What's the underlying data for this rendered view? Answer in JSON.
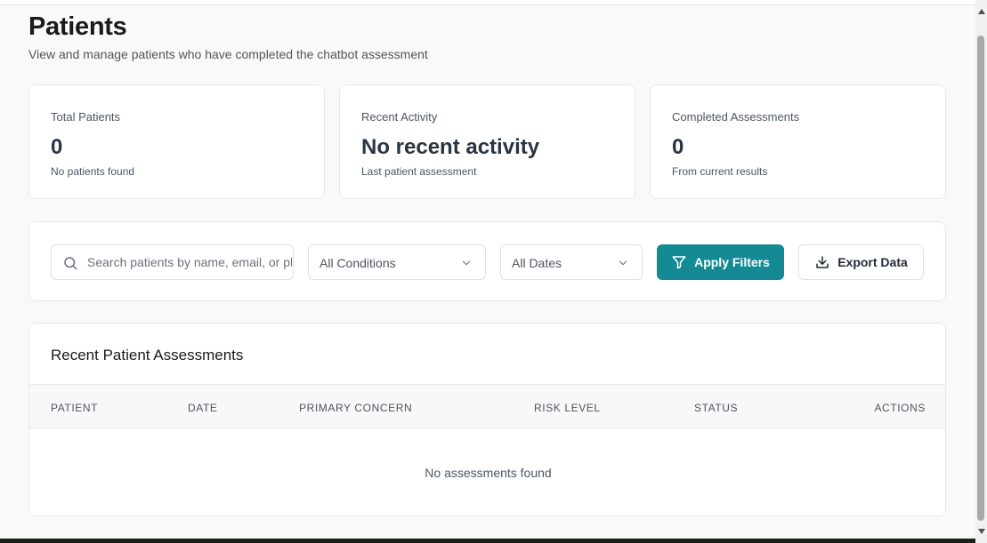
{
  "header": {
    "title": "Patients",
    "subtitle": "View and manage patients who have completed the chatbot assessment"
  },
  "stats": [
    {
      "label": "Total Patients",
      "value": "0",
      "sub": "No patients found"
    },
    {
      "label": "Recent Activity",
      "value": "No recent activity",
      "sub": "Last patient assessment"
    },
    {
      "label": "Completed Assessments",
      "value": "0",
      "sub": "From current results"
    }
  ],
  "filters": {
    "search_placeholder": "Search patients by name, email, or phone...",
    "condition_value": "All Conditions",
    "date_value": "All Dates",
    "apply_label": "Apply Filters",
    "export_label": "Export Data"
  },
  "table": {
    "title": "Recent Patient Assessments",
    "columns": [
      "PATIENT",
      "DATE",
      "PRIMARY CONCERN",
      "RISK LEVEL",
      "STATUS",
      "ACTIONS"
    ],
    "empty_text": "No assessments found"
  },
  "colors": {
    "accent": "#138a94",
    "background": "#f9f9f9"
  }
}
